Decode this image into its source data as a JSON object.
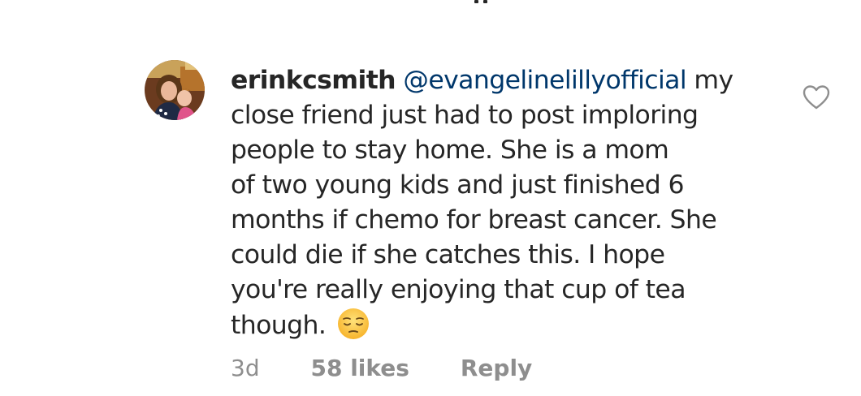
{
  "comment": {
    "username": "erinkcsmith",
    "mention": "@evangelinelillyofficial",
    "text_lines": [
      " my",
      "close friend just had to post imploring",
      "people to stay home. She is a mom",
      "of two young kids and just finished 6",
      "months if chemo for breast cancer. She",
      "could die if she catches this. I hope",
      "you're really enjoying that cup of tea",
      "though."
    ],
    "emoji": "pensive-face-emoji",
    "timestamp": "3d",
    "likes": "58 likes",
    "reply_label": "Reply"
  },
  "icons": {
    "like": "heart-outline-icon",
    "avatar": "user-avatar-photo"
  },
  "colors": {
    "text": "#262626",
    "mention": "#00376b",
    "meta": "#8e8e8e",
    "heart": "#8e8e8e"
  }
}
